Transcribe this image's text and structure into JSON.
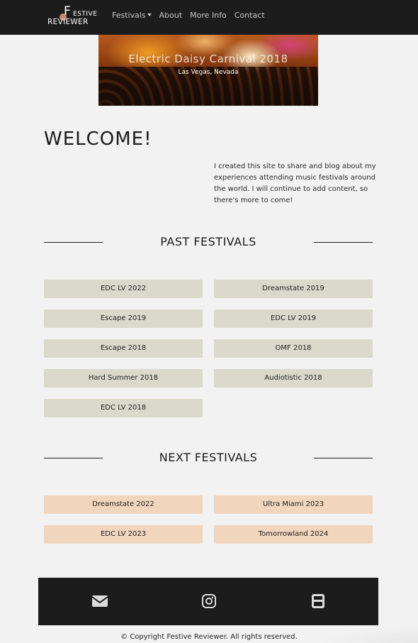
{
  "nav": {
    "logo_f": "F",
    "logo_estive": "ESTIVE",
    "logo_reviewer": "REVIEWER",
    "links": [
      "Festivals",
      "About",
      "More Info",
      "Contact"
    ]
  },
  "hero": {
    "title": "Electric Daisy Carnival 2018",
    "subtitle": "Las Vegas, Nevada"
  },
  "welcome": {
    "heading": "WELCOME!",
    "intro": "I created this site to share and blog about my experiences attending music festivals around the world. I will continue to add content, so there's more to come!"
  },
  "past": {
    "heading": "PAST FESTIVALS",
    "items": [
      "EDC LV 2022",
      "Dreamstate 2019",
      "Escape 2019",
      "EDC LV 2019",
      "Escape 2018",
      "OMF 2018",
      "Hard Summer 2018",
      "Audiotistic 2018",
      "EDC LV 2018"
    ]
  },
  "next": {
    "heading": "NEXT FESTIVALS",
    "items": [
      "Dreamstate 2022",
      "Ultra Miami 2023",
      "EDC LV 2023",
      "Tomorrowland 2024"
    ]
  },
  "footer": {
    "icons": [
      "envelope-icon",
      "instagram-icon",
      "youtube-icon"
    ],
    "copyright": "© Copyright Festive Reviewer. All rights reserved."
  },
  "colors": {
    "navbar": "#1c1c1c",
    "past_button": "#dad9cb",
    "next_button": "#f2d5bd",
    "background": "#f2f2f2"
  }
}
